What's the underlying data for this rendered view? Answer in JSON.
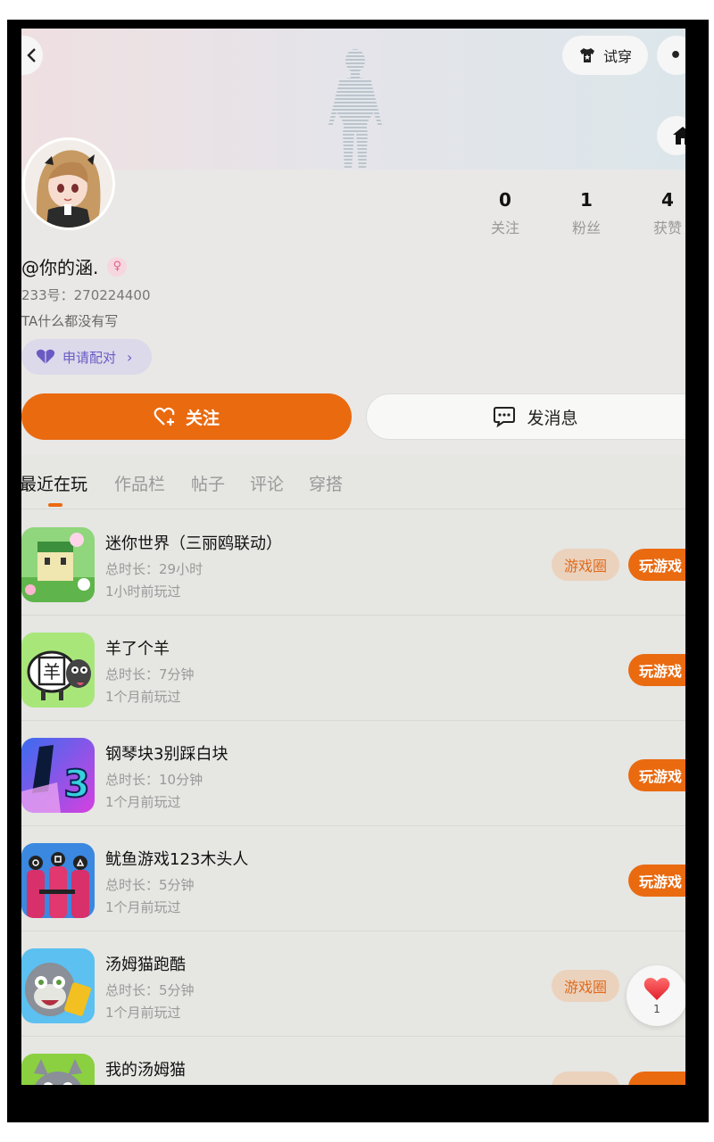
{
  "header": {
    "back_icon": "chevron-left-icon",
    "tryon_label": "试穿",
    "more_icon": "more-dots-icon",
    "home_icon": "home-icon"
  },
  "profile": {
    "username": "@你的涵.",
    "gender_icon": "female-icon",
    "uid": "233号：270224400",
    "bio": "TA什么都没有写",
    "pair_label": "申请配对",
    "stats": [
      {
        "value": "0",
        "label": "关注"
      },
      {
        "value": "1",
        "label": "粉丝"
      },
      {
        "value": "4",
        "label": "获赞"
      }
    ]
  },
  "actions": {
    "follow_label": "关注",
    "message_label": "发消息"
  },
  "tabs": [
    "最近在玩",
    "作品栏",
    "帖子",
    "评论",
    "穿搭"
  ],
  "games": [
    {
      "name": "迷你世界（三丽鸥联动）",
      "duration": "总时长：29小时",
      "last_played": "1小时前玩过",
      "circle_label": "游戏圈",
      "play_label": "玩游戏"
    },
    {
      "name": "羊了个羊",
      "duration": "总时长：7分钟",
      "last_played": "1个月前玩过",
      "play_label": "玩游戏"
    },
    {
      "name": "钢琴块3别踩白块",
      "duration": "总时长：10分钟",
      "last_played": "1个月前玩过",
      "play_label": "玩游戏"
    },
    {
      "name": "鱿鱼游戏123木头人",
      "duration": "总时长：5分钟",
      "last_played": "1个月前玩过",
      "play_label": "玩游戏"
    },
    {
      "name": "汤姆猫跑酷",
      "duration": "总时长：5分钟",
      "last_played": "1个月前玩过",
      "circle_label": "游戏圈"
    },
    {
      "name": "我的汤姆猫"
    }
  ],
  "like_float": {
    "count": "1"
  },
  "colors": {
    "accent": "#ea6a10",
    "pair_text": "#6a5bc4"
  }
}
